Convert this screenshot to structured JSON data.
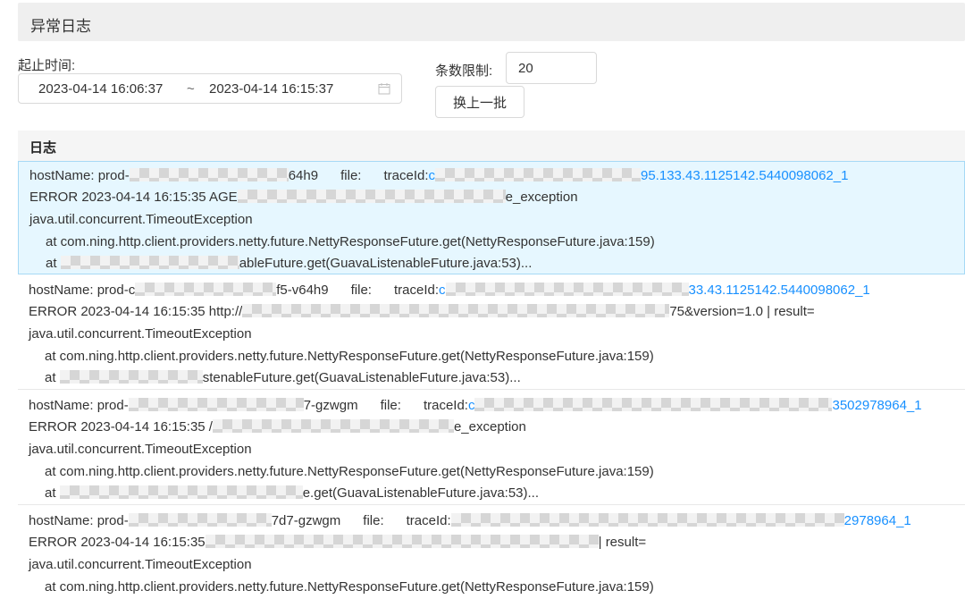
{
  "panel": {
    "title": "异常日志"
  },
  "filters": {
    "time_label": "起止时间:",
    "start_time": "2023-04-14 16:06:37",
    "separator": "~",
    "end_time": "2023-04-14 16:15:37",
    "limit_label": "条数限制:",
    "limit_value": "20",
    "refresh_button": "换上一批"
  },
  "logs_header": "日志",
  "log_entries": [
    {
      "host_prefix": "hostName: prod-",
      "host_suffix": "64h9",
      "file_label": "file:",
      "trace_label": "traceId:",
      "trace_prefix": "c",
      "trace_suffix": "95.133.43.1125142.5440098062_1",
      "error_prefix": "ERROR 2023-04-14 16:15:35 AGE",
      "error_suffix": "e_exception",
      "exception": "java.util.concurrent.TimeoutException",
      "stack1": "at com.ning.http.client.providers.netty.future.NettyResponseFuture.get(NettyResponseFuture.java:159)",
      "stack2_prefix": "at",
      "stack2_suffix": "ableFuture.get(GuavaListenableFuture.java:53)..."
    },
    {
      "host_prefix": "hostName: prod-c",
      "host_suffix": "f5-v64h9",
      "file_label": "file:",
      "trace_label": "traceId:",
      "trace_prefix": "c",
      "trace_suffix": "33.43.1125142.5440098062_1",
      "error_prefix": "ERROR 2023-04-14 16:15:35 http://",
      "error_suffix": "75&version=1.0 | result=",
      "exception": "java.util.concurrent.TimeoutException",
      "stack1": "at com.ning.http.client.providers.netty.future.NettyResponseFuture.get(NettyResponseFuture.java:159)",
      "stack2_prefix": "at",
      "stack2_suffix": "stenableFuture.get(GuavaListenableFuture.java:53)..."
    },
    {
      "host_prefix": "hostName: prod-",
      "host_suffix": "7-gzwgm",
      "file_label": "file:",
      "trace_label": "traceId:",
      "trace_prefix": "c",
      "trace_suffix": "3502978964_1",
      "error_prefix": "ERROR 2023-04-14 16:15:35 /",
      "error_suffix": "e_exception",
      "exception": "java.util.concurrent.TimeoutException",
      "stack1": "at com.ning.http.client.providers.netty.future.NettyResponseFuture.get(NettyResponseFuture.java:159)",
      "stack2_prefix": "at",
      "stack2_suffix": "e.get(GuavaListenableFuture.java:53)..."
    },
    {
      "host_prefix": "hostName: prod-",
      "host_suffix": "7d7-gzwgm",
      "file_label": "file:",
      "trace_label": "traceId:",
      "trace_prefix": "",
      "trace_suffix": "2978964_1",
      "error_prefix": "ERROR 2023-04-14 16:15:35",
      "error_suffix": "| result=",
      "exception": "java.util.concurrent.TimeoutException",
      "stack1": "at com.ning.http.client.providers.netty.future.NettyResponseFuture.get(NettyResponseFuture.java:159)",
      "stack2_prefix": "",
      "stack2_suffix": ""
    }
  ]
}
